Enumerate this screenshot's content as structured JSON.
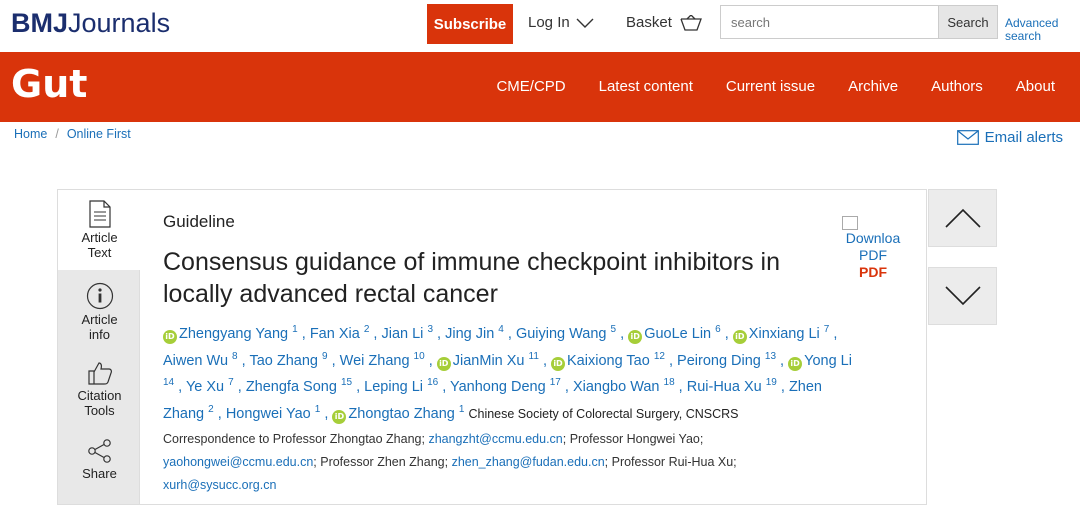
{
  "header": {
    "logo_bold": "BMJ",
    "logo_rest": "Journals",
    "subscribe": "Subscribe",
    "login": "Log In",
    "basket": "Basket",
    "search_placeholder": "search",
    "search_button": "Search",
    "advanced_line1": "Advanced",
    "advanced_line2": "search"
  },
  "nav": {
    "journal": "Gut",
    "links": [
      "CME/CPD",
      "Latest content",
      "Current issue",
      "Archive",
      "Authors",
      "About"
    ]
  },
  "breadcrumb": {
    "home": "Home",
    "sep": "/",
    "current": "Online First"
  },
  "email_alerts": "Email alerts",
  "tools": {
    "article_text_1": "Article",
    "article_text_2": "Text",
    "article_info_1": "Article",
    "article_info_2": "info",
    "citation_1": "Citation",
    "citation_2": "Tools",
    "share": "Share"
  },
  "article": {
    "type": "Guideline",
    "title": "Consensus guidance of immune checkpoint inhibitors in locally advanced rectal cancer",
    "pdf_alt_1": "Downloa",
    "pdf_alt_2": "PDF",
    "pdf_label": "PDF",
    "orcid_glyph": "iD",
    "authors": [
      {
        "name": "Zhengyang Yang",
        "sup": "1",
        "orcid": true
      },
      {
        "name": "Fan Xia",
        "sup": "2",
        "orcid": false
      },
      {
        "name": "Jian Li",
        "sup": "3",
        "orcid": false
      },
      {
        "name": "Jing Jin",
        "sup": "4",
        "orcid": false
      },
      {
        "name": "Guiying Wang",
        "sup": "5",
        "orcid": false
      },
      {
        "name": "GuoLe Lin",
        "sup": "6",
        "orcid": true
      },
      {
        "name": "Xinxiang Li",
        "sup": "7",
        "orcid": true
      },
      {
        "name": "Aiwen Wu",
        "sup": "8",
        "orcid": false
      },
      {
        "name": "Tao Zhang",
        "sup": "9",
        "orcid": false
      },
      {
        "name": "Wei Zhang",
        "sup": "10",
        "orcid": false
      },
      {
        "name": "JianMin Xu",
        "sup": "11",
        "orcid": true
      },
      {
        "name": "Kaixiong Tao",
        "sup": "12",
        "orcid": true
      },
      {
        "name": "Peirong Ding",
        "sup": "13",
        "orcid": false
      },
      {
        "name": "Yong Li",
        "sup": "14",
        "orcid": true
      },
      {
        "name": "Ye Xu",
        "sup": "7",
        "orcid": false
      },
      {
        "name": "Zhengfa Song",
        "sup": "15",
        "orcid": false
      },
      {
        "name": "Leping Li",
        "sup": "16",
        "orcid": false
      },
      {
        "name": "Yanhong Deng",
        "sup": "17",
        "orcid": false
      },
      {
        "name": "Xiangbo Wan",
        "sup": "18",
        "orcid": false
      },
      {
        "name": "Rui-Hua Xu",
        "sup": "19",
        "orcid": false
      },
      {
        "name": "Zhen Zhang",
        "sup": "2",
        "orcid": false
      },
      {
        "name": "Hongwei Yao",
        "sup": "1",
        "orcid": false
      },
      {
        "name": "Zhongtao Zhang",
        "sup": "1",
        "orcid": true
      }
    ],
    "group": "Chinese Society of Colorectal Surgery, CNSCRS",
    "correspondence": {
      "prefix": "Correspondence to Professor Zhongtao Zhang;",
      "email1": "zhangzht@ccmu.edu.cn",
      "mid1": "; Professor Hongwei Yao;",
      "email2": "yaohongwei@ccmu.edu.cn",
      "mid2": "; Professor Zhen Zhang;",
      "email3": "zhen_zhang@fudan.edu.cn",
      "mid3": "; Professor Rui-Hua Xu;",
      "email4": "xurh@sysucc.org.cn"
    }
  },
  "colors": {
    "brand_red": "#d9340b",
    "link_blue": "#1a6fb8",
    "orcid_green": "#a6ce39",
    "logo_navy": "#1b2e6e"
  }
}
